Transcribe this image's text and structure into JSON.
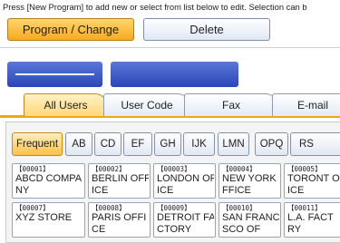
{
  "instruction": "Press [New Program] to add new or select from list below to edit. Selection can b",
  "top_buttons": {
    "program_change": "Program / Change",
    "delete": "Delete"
  },
  "tabs": [
    "All Users",
    "User Code",
    "Fax",
    "E-mail"
  ],
  "index_keys": [
    "Frequent",
    "AB",
    "CD",
    "EF",
    "GH",
    "IJK",
    "LMN",
    "OPQ",
    "RS"
  ],
  "entries": [
    {
      "number": "【00001】",
      "name": "ABCD COMPA\nNY"
    },
    {
      "number": "【00002】",
      "name": "BERLIN OFF\nICE"
    },
    {
      "number": "【00003】",
      "name": "LONDON OFF\nICE"
    },
    {
      "number": "【00004】",
      "name": "NEW YORK O\nFFICE"
    },
    {
      "number": "【00005】",
      "name": "TORONT OF\nICE"
    },
    {
      "number": "【00007】",
      "name": "XYZ STORE"
    },
    {
      "number": "【00008】",
      "name": "PARIS OFFI\nCE"
    },
    {
      "number": "【00009】",
      "name": "DETROIT FA\nCTORY"
    },
    {
      "number": "【00010】",
      "name": "SAN FRANCI\nSCO OF"
    },
    {
      "number": "【00011】",
      "name": "L.A. FACT\nRY"
    }
  ],
  "colors": {
    "accent": "#f7a91e",
    "indicator_blue": "#2a45b6"
  }
}
